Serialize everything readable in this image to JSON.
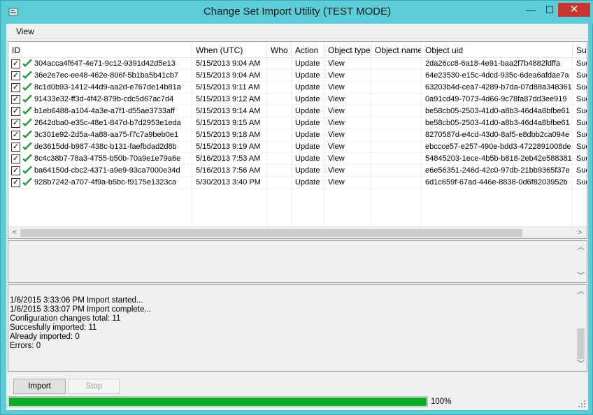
{
  "window": {
    "title": "Change Set Import Utility (TEST MODE)",
    "controls": {
      "minimize": "—",
      "maximize": "☐",
      "close": "✕"
    }
  },
  "menu": {
    "view": "View"
  },
  "grid": {
    "headers": [
      "ID",
      "When (UTC)",
      "Who",
      "Action",
      "Object type",
      "Object name",
      "Object uid",
      "Suc"
    ],
    "rows": [
      {
        "id": "304acca4f647-4e71-9c12-9391d42d5e13",
        "when": "5/15/2013 9:04 AM",
        "who": "",
        "action": "Update",
        "type": "View",
        "name": "",
        "uid": "2da26cc8-6a18-4e91-baa2f7b4882fdffa",
        "suc": "Suc"
      },
      {
        "id": "36e2e7ec-ee48-462e-806f-5b1ba5b41cb7",
        "when": "5/15/2013 9:04 AM",
        "who": "",
        "action": "Update",
        "type": "View",
        "name": "",
        "uid": "64e23530-e15c-4dcd-935c-6dea6afdae7a",
        "suc": "Suc"
      },
      {
        "id": "8c1d0b93-1412-44d9-aa2d-e767de14b81a",
        "when": "5/15/2013 9:11 AM",
        "who": "",
        "action": "Update",
        "type": "View",
        "name": "",
        "uid": "63203b4d-cea7-4289-b7da-07d88a348361",
        "suc": "Suc"
      },
      {
        "id": "91433e32-ff3d-4f42-879b-cdc5d67ac7d4",
        "when": "5/15/2013 9:12 AM",
        "who": "",
        "action": "Update",
        "type": "View",
        "name": "",
        "uid": "0a91cd49-7073-4d66-9c78fa87dd3ee919",
        "suc": "Suc"
      },
      {
        "id": "b1eb6488-a104-4a3e-a7f1-d55ae3733aff",
        "when": "5/15/2013 9:14 AM",
        "who": "",
        "action": "Update",
        "type": "View",
        "name": "",
        "uid": "be58cb05-2503-41d0-a8b3-46d4a8bfbe61",
        "suc": "Suc"
      },
      {
        "id": "2642dba0-e35c-48e1-847d-b7d2953e1eda",
        "when": "5/15/2013 9:15 AM",
        "who": "",
        "action": "Update",
        "type": "View",
        "name": "",
        "uid": "be58cb05-2503-41d0-a8b3-46d4a8bfbe61",
        "suc": "Suc"
      },
      {
        "id": "3c301e92-2d5a-4a88-aa75-f7c7a9beb0e1",
        "when": "5/15/2013 9:18 AM",
        "who": "",
        "action": "Update",
        "type": "View",
        "name": "",
        "uid": "8270587d-e4cd-43d0-8af5-e8dbb2ca094e",
        "suc": "Suc"
      },
      {
        "id": "de3615dd-b987-438c-b131-faefbdad2d8b",
        "when": "5/15/2013 9:19 AM",
        "who": "",
        "action": "Update",
        "type": "View",
        "name": "",
        "uid": "ebccce57-e257-490e-bdd3-4722891008de",
        "suc": "Suc"
      },
      {
        "id": "8c4c38b7-78a3-4755-b50b-70a9e1e79a6e",
        "when": "5/16/2013 7:53 AM",
        "who": "",
        "action": "Update",
        "type": "View",
        "name": "",
        "uid": "54845203-1ece-4b5b-b818-2eb42e588381",
        "suc": "Suc"
      },
      {
        "id": "ba64150d-cbc2-4371-a9e9-93ca7000e34d",
        "when": "5/16/2013 7:56 AM",
        "who": "",
        "action": "Update",
        "type": "View",
        "name": "",
        "uid": "e6e56351-246d-42c0-97db-21bb9365f37e",
        "suc": "Suc"
      },
      {
        "id": "928b7242-a707-4f9a-b5bc-f9175e1323ca",
        "when": "5/30/2013 3:40 PM",
        "who": "",
        "action": "Update",
        "type": "View",
        "name": "",
        "uid": "6d1c659f-67ad-446e-8838-0d6f8203952b",
        "suc": "Suc"
      }
    ]
  },
  "log": {
    "lines": [
      "1/6/2015 3:33:06 PM Import started...",
      "1/6/2015 3:33:07 PM Import complete...",
      "Configuration changes total: 11",
      "Succesfully imported: 11",
      "Already imported: 0",
      "Errors: 0"
    ]
  },
  "buttons": {
    "import": "Import",
    "stop": "Stop"
  },
  "progress": {
    "value": 1.0,
    "label": "100%"
  },
  "icons": {
    "checkbox": "checkbox-icon",
    "success": "green-checkmark-icon",
    "scroll": "scroll-arrow-icon"
  },
  "colors": {
    "titlebar": "#5bcdd8",
    "close": "#c7372f",
    "progress": "#06b025",
    "check": "#1f9e36"
  }
}
